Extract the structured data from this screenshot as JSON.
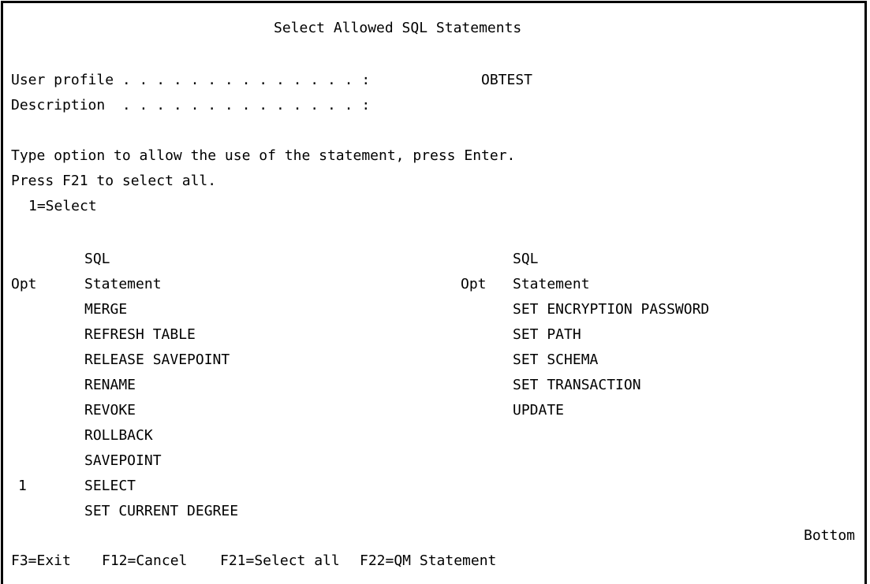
{
  "screen": {
    "title": "Select Allowed SQL Statements",
    "user_profile_label": "User profile . . . . . . . . . . . . . . :",
    "user_profile_value": "OBTEST",
    "description_label": "Description  . . . . . . . . . . . . . . :",
    "description_value": "",
    "instruction_1": "Type option to allow the use of the statement, press Enter.",
    "instruction_2": "Press F21 to select all.",
    "option_legend": "1=Select",
    "col_header_sql": "SQL",
    "col_header_opt": "Opt",
    "col_header_statement": "Statement",
    "left_rows": [
      {
        "opt": "",
        "statement": "MERGE"
      },
      {
        "opt": "",
        "statement": "REFRESH TABLE"
      },
      {
        "opt": "",
        "statement": "RELEASE SAVEPOINT"
      },
      {
        "opt": "",
        "statement": "RENAME"
      },
      {
        "opt": "",
        "statement": "REVOKE"
      },
      {
        "opt": "",
        "statement": "ROLLBACK"
      },
      {
        "opt": "",
        "statement": "SAVEPOINT"
      },
      {
        "opt": "1",
        "statement": "SELECT"
      },
      {
        "opt": "",
        "statement": "SET CURRENT DEGREE"
      }
    ],
    "right_rows": [
      {
        "opt": "",
        "statement": "SET ENCRYPTION PASSWORD"
      },
      {
        "opt": "",
        "statement": "SET PATH"
      },
      {
        "opt": "",
        "statement": "SET SCHEMA"
      },
      {
        "opt": "",
        "statement": "SET TRANSACTION"
      },
      {
        "opt": "",
        "statement": "UPDATE"
      }
    ],
    "scroll_indicator": "Bottom",
    "function_keys": [
      "F3=Exit",
      "F12=Cancel",
      "F21=Select all",
      "F22=QM Statement"
    ]
  }
}
